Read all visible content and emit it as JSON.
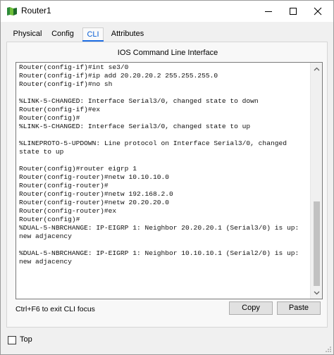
{
  "window": {
    "title": "Router1",
    "controls": {
      "minimize": "–",
      "maximize": "□",
      "close": "✕"
    }
  },
  "tabs": [
    {
      "label": "Physical",
      "active": false
    },
    {
      "label": "Config",
      "active": false
    },
    {
      "label": "CLI",
      "active": true
    },
    {
      "label": "Attributes",
      "active": false
    }
  ],
  "cli": {
    "panel_title": "IOS Command Line Interface",
    "lines": [
      "Router(config-if)#int se3/0",
      "Router(config-if)#ip add 20.20.20.2 255.255.255.0",
      "Router(config-if)#no sh",
      "",
      "%LINK-5-CHANGED: Interface Serial3/0, changed state to down",
      "Router(config-if)#ex",
      "Router(config)#",
      "%LINK-5-CHANGED: Interface Serial3/0, changed state to up",
      "",
      "%LINEPROTO-5-UPDOWN: Line protocol on Interface Serial3/0, changed",
      "state to up",
      "",
      "Router(config)#router eigrp 1",
      "Router(config-router)#netw 10.10.10.0",
      "Router(config-router)#",
      "Router(config-router)#netw 192.168.2.0",
      "Router(config-router)#netw 20.20.20.0",
      "Router(config-router)#ex",
      "Router(config)#",
      "%DUAL-5-NBRCHANGE: IP-EIGRP 1: Neighbor 20.20.20.1 (Serial3/0) is up:",
      "new adjacency",
      "",
      "%DUAL-5-NBRCHANGE: IP-EIGRP 1: Neighbor 10.10.10.1 (Serial2/0) is up:",
      "new adjacency"
    ],
    "hint": "Ctrl+F6 to exit CLI focus",
    "copy_label": "Copy",
    "paste_label": "Paste"
  },
  "footer": {
    "top_label": "Top",
    "top_checked": false
  },
  "colors": {
    "accent": "#1f6fe5",
    "icon_green": "#2e8b3a"
  }
}
